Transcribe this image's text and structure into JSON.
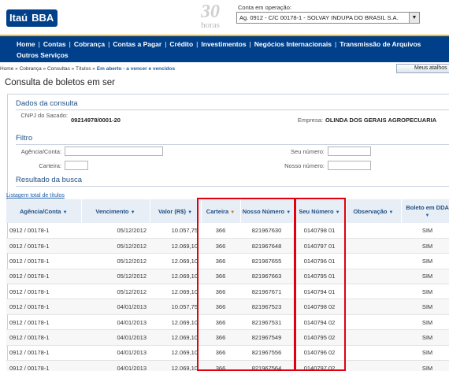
{
  "header": {
    "logo_itau": "Itaú",
    "logo_bba": "BBA",
    "badge_number": "30",
    "badge_text": "horas",
    "account_label": "Conta em operação:",
    "account_value": "Ag. 0912 - C/C 00178-1 - SOLVAY INDUPA DO BRASIL S.A."
  },
  "nav": {
    "items": [
      "Home",
      "Contas",
      "Cobrança",
      "Contas a Pagar",
      "Crédito",
      "Investimentos",
      "Negócios Internacionais",
      "Transmissão de Arquivos"
    ],
    "items_row2": [
      "Outros Serviços"
    ]
  },
  "breadcrumb": {
    "path": "Home » Cobrança » Consultas » Títulos » ",
    "current": "Em aberto - a vencer e vencidos"
  },
  "shortcuts_label": "Meus atalhos",
  "page_title": "Consulta de boletos em ser",
  "consulta": {
    "title": "Dados da consulta",
    "cnpj_label": "CNPJ do Sacado:",
    "cnpj_value": "09214978/0001-20",
    "empresa_label": "Empresa:",
    "empresa_value": "OLINDA DOS GERAIS AGROPECUARIA"
  },
  "filtro": {
    "title": "Filtro",
    "agencia_label": "Agência/Conta:",
    "carteira_label": "Carteira:",
    "seu_numero_label": "Seu número:",
    "nosso_numero_label": "Nosso número:"
  },
  "resultado": {
    "title": "Resultado da busca",
    "listagem_link": "Listagem total de títulos",
    "columns": [
      "Agência/Conta",
      "Vencimento",
      "Valor (R$)",
      "Carteira",
      "Nosso Número",
      "Seu Número",
      "Observação",
      "Boleto em DDA"
    ],
    "rows": [
      [
        "0912 / 00178-1",
        "05/12/2012",
        "10.057,75",
        "366",
        "821967630",
        "0140798 01",
        "",
        "SIM"
      ],
      [
        "0912 / 00178-1",
        "05/12/2012",
        "12.069,10",
        "366",
        "821967648",
        "0140797 01",
        "",
        "SIM"
      ],
      [
        "0912 / 00178-1",
        "05/12/2012",
        "12.069,10",
        "366",
        "821967655",
        "0140796 01",
        "",
        "SIM"
      ],
      [
        "0912 / 00178-1",
        "05/12/2012",
        "12.069,10",
        "366",
        "821967663",
        "0140795 01",
        "",
        "SIM"
      ],
      [
        "0912 / 00178-1",
        "05/12/2012",
        "12.069,10",
        "366",
        "821967671",
        "0140794 01",
        "",
        "SIM"
      ],
      [
        "0912 / 00178-1",
        "04/01/2013",
        "10.057,75",
        "366",
        "821967523",
        "0140798 02",
        "",
        "SIM"
      ],
      [
        "0912 / 00178-1",
        "04/01/2013",
        "12.069,10",
        "366",
        "821967531",
        "0140794 02",
        "",
        "SIM"
      ],
      [
        "0912 / 00178-1",
        "04/01/2013",
        "12.069,10",
        "366",
        "821967549",
        "0140795 02",
        "",
        "SIM"
      ],
      [
        "0912 / 00178-1",
        "04/01/2013",
        "12.069,10",
        "366",
        "821967556",
        "0140796 02",
        "",
        "SIM"
      ],
      [
        "0912 / 00178-1",
        "04/01/2013",
        "12.069,10",
        "366",
        "821967564",
        "0140797 02",
        "",
        "SIM"
      ]
    ]
  },
  "colors": {
    "brand_blue": "#003f8a",
    "accent_yellow": "#ffcc00",
    "highlight_red": "#e0000f"
  }
}
